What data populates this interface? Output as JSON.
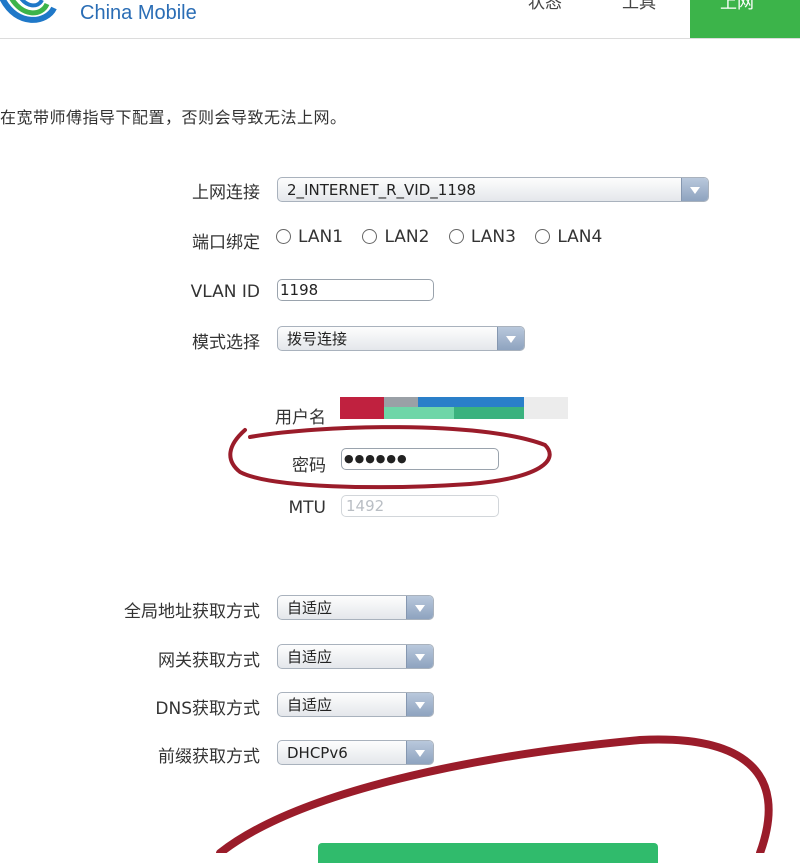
{
  "header": {
    "brand": "China Mobile",
    "nav": [
      "状态",
      "工具",
      "上网"
    ],
    "active_nav": "上网",
    "accent_color": "#3cb44a",
    "brand_color": "#2a6db5"
  },
  "notice": "在宽带师傅指导下配置，否则会导致无法上网。",
  "form": {
    "connection": {
      "label": "上网连接",
      "value": "2_INTERNET_R_VID_1198"
    },
    "port_binding": {
      "label": "端口绑定",
      "options": [
        "LAN1",
        "LAN2",
        "LAN3",
        "LAN4"
      ]
    },
    "vlan_id": {
      "label": "VLAN ID",
      "value": "1198"
    },
    "mode": {
      "label": "模式选择",
      "value": "拨号连接"
    },
    "username": {
      "label": "用户名"
    },
    "password": {
      "label": "密码",
      "value": "●●●●●●"
    },
    "mtu": {
      "label": "MTU",
      "value": "1492"
    },
    "global_address": {
      "label": "全局地址获取方式",
      "value": "自适应"
    },
    "gateway": {
      "label": "网关获取方式",
      "value": "自适应"
    },
    "dns": {
      "label": "DNS获取方式",
      "value": "自适应"
    },
    "prefix": {
      "label": "前缀获取方式",
      "value": "DHCPv6"
    }
  },
  "annotation_color": "#9a1c2a"
}
